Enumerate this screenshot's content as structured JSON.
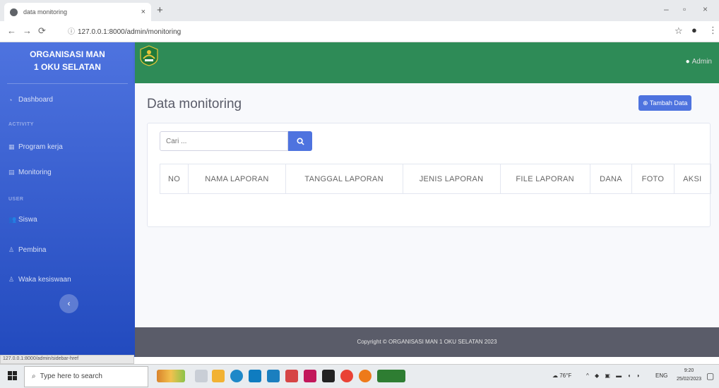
{
  "browser": {
    "tab_title": "data monitoring",
    "tab_close": "×",
    "new_tab": "+",
    "url": "127.0.0.1:8000/admin/monitoring",
    "win_min": "–",
    "win_max": "▫",
    "win_close": "×"
  },
  "sidebar": {
    "brand_line1": "ORGANISASI MAN",
    "brand_line2": "1 OKU SELATAN",
    "items": [
      {
        "label": "Dashboard",
        "icon": "gauge-icon"
      },
      {
        "label": "Program kerja",
        "icon": "table-icon"
      },
      {
        "label": "Monitoring",
        "icon": "document-icon"
      },
      {
        "label": "Siswa",
        "icon": "users-icon"
      },
      {
        "label": "Pembina",
        "icon": "user-icon"
      },
      {
        "label": "Waka kesiswaan",
        "icon": "user-icon"
      }
    ],
    "headings": [
      "ACTIVITY",
      "USER"
    ],
    "toggle_glyph": "‹",
    "status_url": "127.0.0.1:8000/admin/sidebar-href"
  },
  "topbar": {
    "user": "Admin",
    "colors": {
      "topbar": "#2e8b57",
      "sidebar": "#4e73df"
    }
  },
  "main": {
    "title": "Data monitoring",
    "add_button": "Tambah Data",
    "search_placeholder": "Cari ...",
    "columns": [
      "NO",
      "NAMA LAPORAN",
      "TANGGAL LAPORAN",
      "JENIS LAPORAN",
      "FILE LAPORAN",
      "DANA",
      "FOTO",
      "AKSI"
    ]
  },
  "footer": {
    "text": "Copyright © ORGANISASI MAN 1 OKU SELATAN 2023"
  },
  "taskbar": {
    "search": "Type here to search",
    "weather": "76°F",
    "lang": "ENG",
    "time": "9:20",
    "date": "25/02/2023"
  }
}
